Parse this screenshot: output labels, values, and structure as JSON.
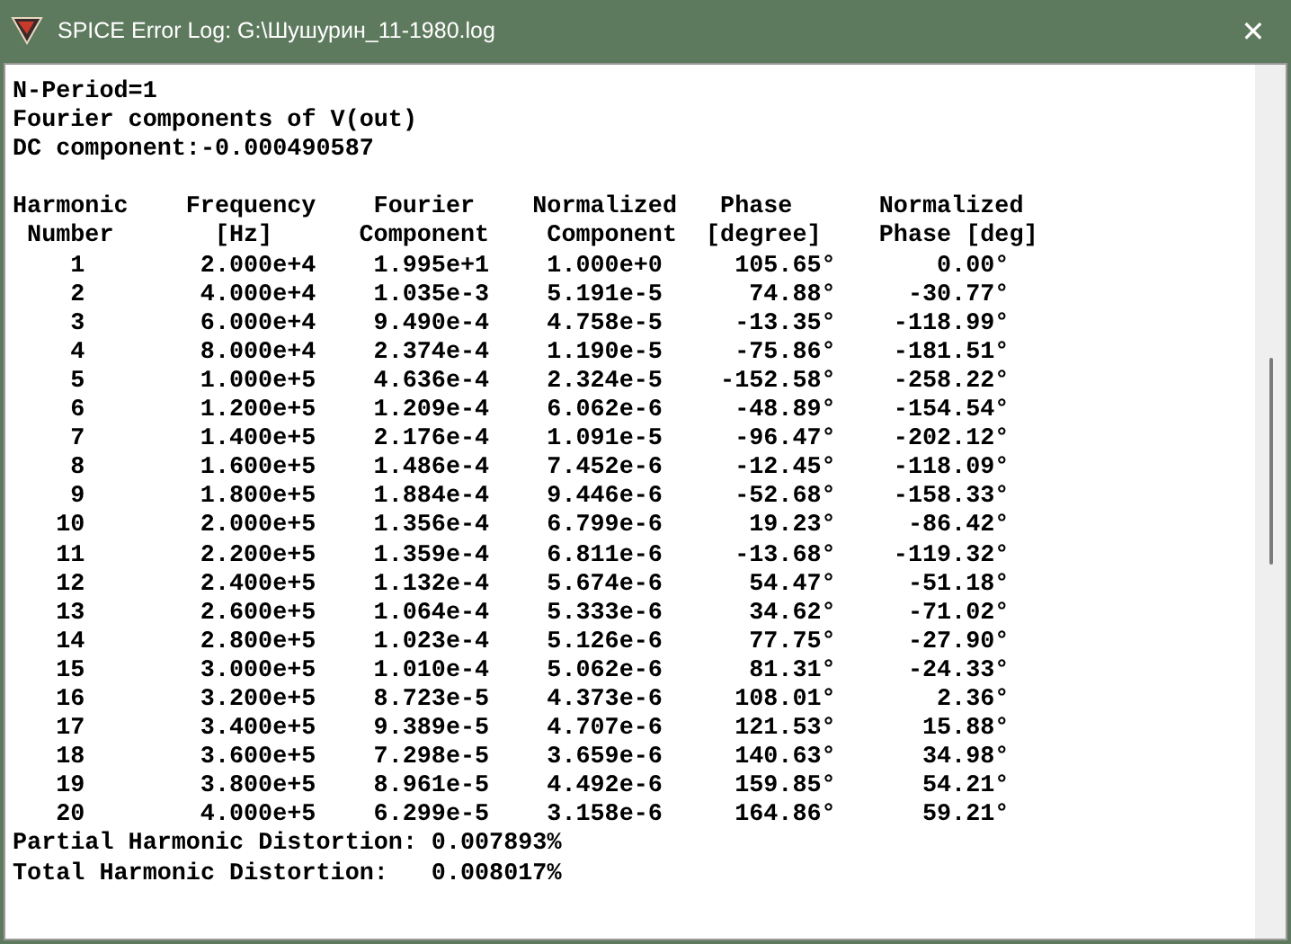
{
  "window": {
    "title": "SPICE Error Log: G:\\Шушурин_11-1980.log",
    "close": "✕"
  },
  "preamble": [
    "N-Period=1",
    "Fourier components of V(out)",
    "DC component:-0.000490587"
  ],
  "table": {
    "columns": [
      {
        "title": "Harmonic",
        "subtitle": "Number"
      },
      {
        "title": "Frequency",
        "subtitle": "[Hz]"
      },
      {
        "title": "Fourier",
        "subtitle": "Component"
      },
      {
        "title": "Normalized",
        "subtitle": "Component"
      },
      {
        "title": "Phase",
        "subtitle": "[degree]"
      },
      {
        "title": "Normalized",
        "subtitle": "Phase [deg]"
      }
    ],
    "rows": [
      [
        "1",
        "2.000e+4",
        "1.995e+1",
        "1.000e+0",
        "105.65°",
        "0.00°"
      ],
      [
        "2",
        "4.000e+4",
        "1.035e-3",
        "5.191e-5",
        "74.88°",
        "-30.77°"
      ],
      [
        "3",
        "6.000e+4",
        "9.490e-4",
        "4.758e-5",
        "-13.35°",
        "-118.99°"
      ],
      [
        "4",
        "8.000e+4",
        "2.374e-4",
        "1.190e-5",
        "-75.86°",
        "-181.51°"
      ],
      [
        "5",
        "1.000e+5",
        "4.636e-4",
        "2.324e-5",
        "-152.58°",
        "-258.22°"
      ],
      [
        "6",
        "1.200e+5",
        "1.209e-4",
        "6.062e-6",
        "-48.89°",
        "-154.54°"
      ],
      [
        "7",
        "1.400e+5",
        "2.176e-4",
        "1.091e-5",
        "-96.47°",
        "-202.12°"
      ],
      [
        "8",
        "1.600e+5",
        "1.486e-4",
        "7.452e-6",
        "-12.45°",
        "-118.09°"
      ],
      [
        "9",
        "1.800e+5",
        "1.884e-4",
        "9.446e-6",
        "-52.68°",
        "-158.33°"
      ],
      [
        "10",
        "2.000e+5",
        "1.356e-4",
        "6.799e-6",
        "19.23°",
        "-86.42°"
      ],
      [
        "11",
        "2.200e+5",
        "1.359e-4",
        "6.811e-6",
        "-13.68°",
        "-119.32°"
      ],
      [
        "12",
        "2.400e+5",
        "1.132e-4",
        "5.674e-6",
        "54.47°",
        "-51.18°"
      ],
      [
        "13",
        "2.600e+5",
        "1.064e-4",
        "5.333e-6",
        "34.62°",
        "-71.02°"
      ],
      [
        "14",
        "2.800e+5",
        "1.023e-4",
        "5.126e-6",
        "77.75°",
        "-27.90°"
      ],
      [
        "15",
        "3.000e+5",
        "1.010e-4",
        "5.062e-6",
        "81.31°",
        "-24.33°"
      ],
      [
        "16",
        "3.200e+5",
        "8.723e-5",
        "4.373e-6",
        "108.01°",
        "2.36°"
      ],
      [
        "17",
        "3.400e+5",
        "9.389e-5",
        "4.707e-6",
        "121.53°",
        "15.88°"
      ],
      [
        "18",
        "3.600e+5",
        "7.298e-5",
        "3.659e-6",
        "140.63°",
        "34.98°"
      ],
      [
        "19",
        "3.800e+5",
        "8.961e-5",
        "4.492e-6",
        "159.85°",
        "54.21°"
      ],
      [
        "20",
        "4.000e+5",
        "6.299e-5",
        "3.158e-6",
        "164.86°",
        "59.21°"
      ]
    ]
  },
  "summary": [
    {
      "label": "Partial Harmonic Distortion:",
      "value": "0.007893%"
    },
    {
      "label": "Total Harmonic Distortion:",
      "value": "0.008017%"
    }
  ]
}
